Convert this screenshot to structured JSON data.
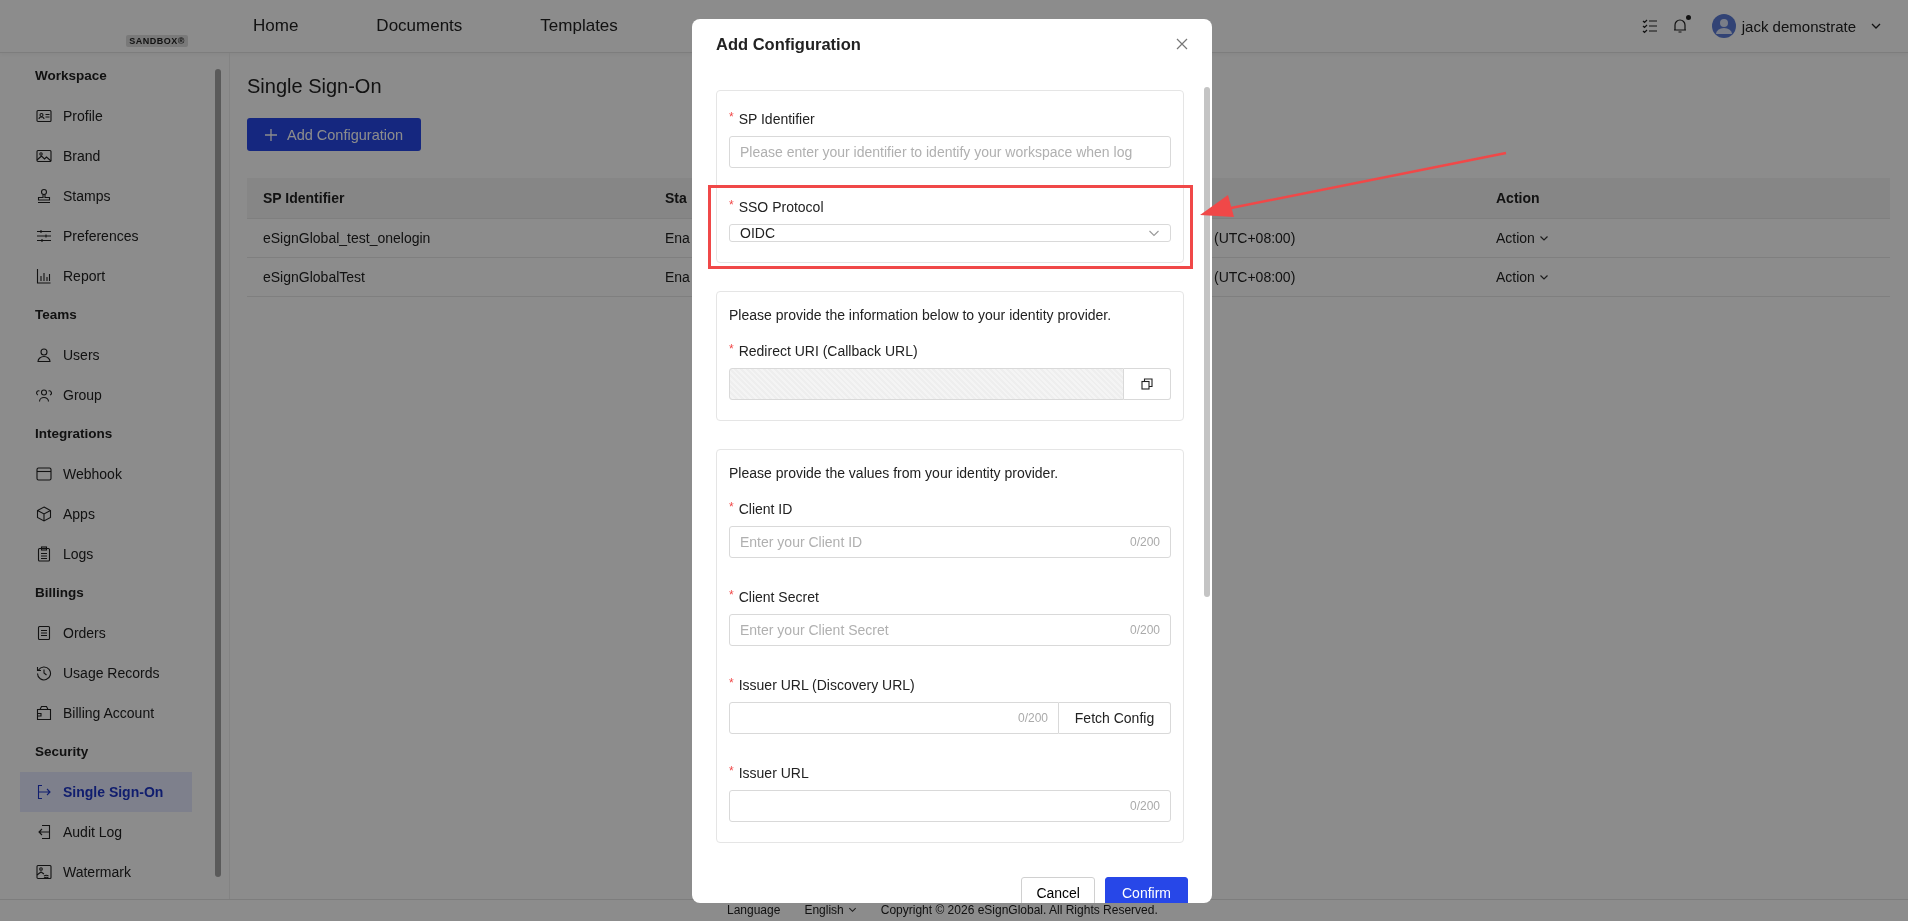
{
  "header": {
    "badge": "SANDBOX®",
    "nav": [
      "Home",
      "Documents",
      "Templates"
    ],
    "notifications": {
      "unread": true
    },
    "user": {
      "name": "jack demonstrate"
    }
  },
  "sidebar": {
    "groups": [
      {
        "title": "Workspace",
        "items": [
          {
            "label": "Profile",
            "selected": false
          },
          {
            "label": "Brand",
            "selected": false
          },
          {
            "label": "Stamps",
            "selected": false
          },
          {
            "label": "Preferences",
            "selected": false
          },
          {
            "label": "Report",
            "selected": false
          }
        ]
      },
      {
        "title": "Teams",
        "items": [
          {
            "label": "Users",
            "selected": false
          },
          {
            "label": "Group",
            "selected": false
          }
        ]
      },
      {
        "title": "Integrations",
        "items": [
          {
            "label": "Webhook",
            "selected": false
          },
          {
            "label": "Apps",
            "selected": false
          },
          {
            "label": "Logs",
            "selected": false
          }
        ]
      },
      {
        "title": "Billings",
        "items": [
          {
            "label": "Orders",
            "selected": false
          },
          {
            "label": "Usage Records",
            "selected": false
          },
          {
            "label": "Billing Account",
            "selected": false
          }
        ]
      },
      {
        "title": "Security",
        "items": [
          {
            "label": "Single Sign-On",
            "selected": true
          },
          {
            "label": "Audit Log",
            "selected": false
          },
          {
            "label": "Watermark",
            "selected": false
          }
        ]
      }
    ]
  },
  "main": {
    "title": "Single Sign-On",
    "add_button": "Add Configuration",
    "table": {
      "columns": {
        "sp_identifier": "SP Identifier",
        "column_2": "Sta",
        "action": "Action"
      },
      "rows": [
        {
          "sp_identifier": "eSignGlobal_test_onelogin",
          "column_2": "Ena",
          "column_3": "(UTC+08:00)",
          "action": "Action"
        },
        {
          "sp_identifier": "eSignGlobalTest",
          "column_2": "Ena",
          "column_3": "(UTC+08:00)",
          "action": "Action"
        }
      ]
    }
  },
  "modal": {
    "title": "Add Configuration",
    "sections": [
      {
        "fields": [
          {
            "kind": "input",
            "label": "SP Identifier",
            "required_mark": "*",
            "placeholder": "Please enter your identifier to identify your workspace when log",
            "highlighted": false
          },
          {
            "kind": "select",
            "label": "SSO Protocol",
            "required_mark": "*",
            "value": "OIDC",
            "highlighted": true
          }
        ]
      },
      {
        "intro": "Please provide the information below to your identity provider.",
        "fields": [
          {
            "kind": "readonly",
            "label": "Redirect URI (Callback URL)",
            "required_mark": "*",
            "highlighted": false
          }
        ]
      },
      {
        "intro": "Please provide the values from your identity provider.",
        "fields": [
          {
            "kind": "input",
            "label": "Client ID",
            "required_mark": "*",
            "placeholder": "Enter your Client ID",
            "counter": "0/200",
            "highlighted": false
          },
          {
            "kind": "input",
            "label": "Client Secret",
            "required_mark": "*",
            "placeholder": "Enter your Client Secret",
            "counter": "0/200",
            "highlighted": false
          },
          {
            "kind": "input",
            "label": "Issuer URL (Discovery URL)",
            "required_mark": "*",
            "counter": "0/200",
            "button": "Fetch Config",
            "highlighted": false
          },
          {
            "kind": "input",
            "label": "Issuer URL",
            "required_mark": "*",
            "counter": "0/200",
            "highlighted": false
          }
        ]
      }
    ],
    "cancel": "Cancel",
    "confirm": "Confirm"
  },
  "footer": {
    "language_label": "Language",
    "language": "English",
    "copyright": "Copyright © 2026 eSignGlobal. All Rights Reserved."
  }
}
